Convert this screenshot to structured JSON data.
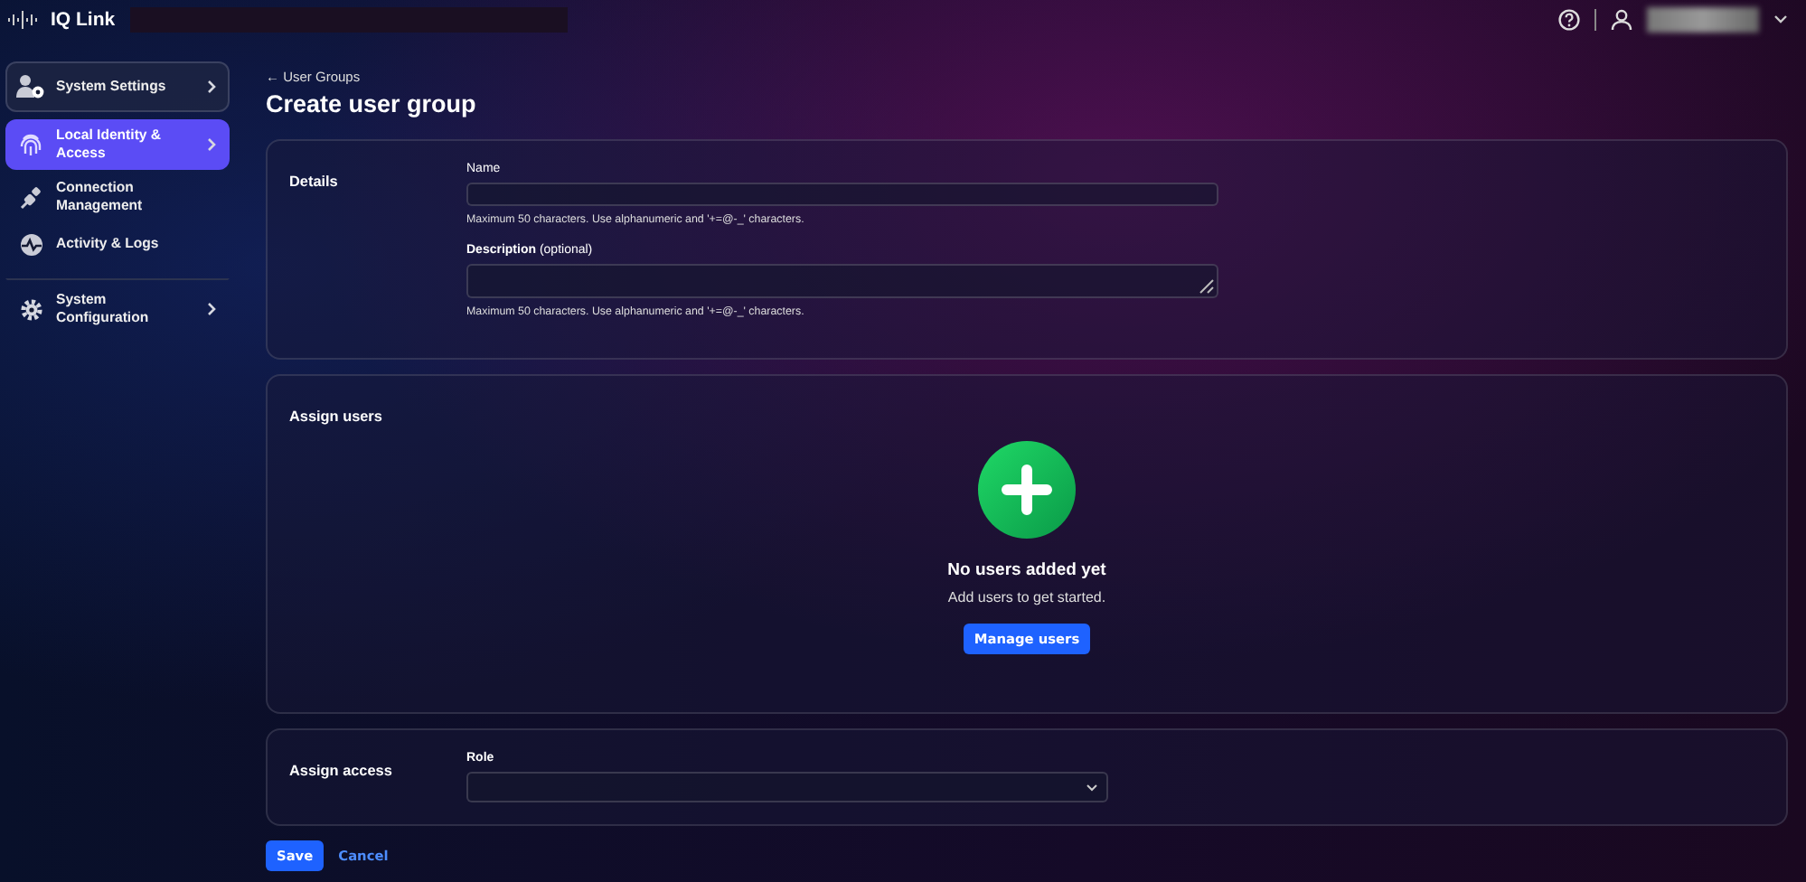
{
  "header": {
    "brand": "IQ Link",
    "menus": [
      {
        "kind": "help"
      },
      {
        "kind": "user"
      }
    ]
  },
  "sidebar": {
    "items": [
      {
        "label": "System Settings",
        "selected": false,
        "has_submenu": true,
        "boxed": true
      },
      {
        "label": "Local Identity & Access",
        "selected": true,
        "has_submenu": true,
        "boxed": false
      },
      {
        "label": "Connection Management",
        "selected": false,
        "has_submenu": false,
        "boxed": false
      },
      {
        "label": "Activity & Logs",
        "selected": false,
        "has_submenu": false,
        "boxed": false
      },
      {
        "label": "System Configuration",
        "selected": false,
        "has_submenu": true,
        "boxed": false,
        "divider_before": true
      }
    ]
  },
  "breadcrumb": "← User Groups",
  "title": "Create user group",
  "details": {
    "heading": "Details",
    "fields": [
      {
        "kind": "input",
        "label": "Name",
        "hint": "Maximum 50 characters. Use alphanumeric and '+=@-_' characters."
      },
      {
        "kind": "textarea",
        "label": "**Description** (optional)",
        "hint": "Maximum 50 characters. Use alphanumeric and '+=@-_' characters."
      }
    ]
  },
  "assign_users": {
    "heading": "Assign users",
    "empty_title": "No users added yet",
    "empty_text": "Add users to get started.",
    "button": "Manage users"
  },
  "assign_access": {
    "heading": "Assign access",
    "field_label": "Role"
  },
  "actions": [
    {
      "label": "Save",
      "kind": "primary"
    },
    {
      "label": "Cancel",
      "kind": "link"
    }
  ]
}
